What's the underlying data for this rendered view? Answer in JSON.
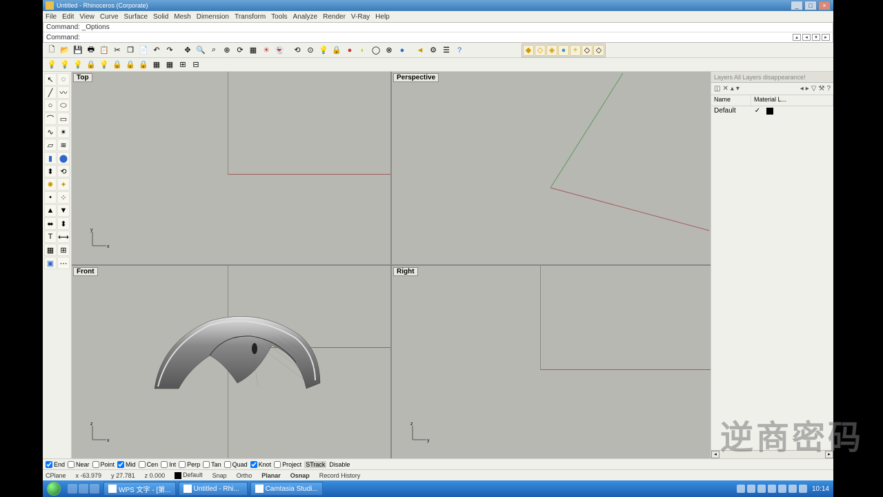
{
  "title": "Untitled - Rhinoceros (Corporate)",
  "menus": [
    "File",
    "Edit",
    "View",
    "Curve",
    "Surface",
    "Solid",
    "Mesh",
    "Dimension",
    "Transform",
    "Tools",
    "Analyze",
    "Render",
    "V-Ray",
    "Help"
  ],
  "cmd_prev": "Command: _Options",
  "cmd_prompt": "Command:",
  "viewports": {
    "top": "Top",
    "persp": "Perspective",
    "front": "Front",
    "right": "Right"
  },
  "layers_panel": {
    "tab": "Layers    All Layers disappearance!",
    "cols": {
      "name": "Name",
      "material": "Material  L..."
    },
    "row": {
      "name": "Default",
      "on": "✓"
    }
  },
  "osnap": {
    "end": "End",
    "near": "Near",
    "point": "Point",
    "mid": "Mid",
    "cen": "Cen",
    "int": "Int",
    "perp": "Perp",
    "tan": "Tan",
    "quad": "Quad",
    "knot": "Knot",
    "project": "Project",
    "strack": "STrack",
    "disable": "Disable"
  },
  "status": {
    "cplane": "CPlane",
    "x": "x -63.979",
    "y": "y 27.781",
    "z": "z 0.000",
    "layer": "Default",
    "snap": "Snap",
    "ortho": "Ortho",
    "planar": "Planar",
    "osnap": "Osnap",
    "record": "Record History"
  },
  "taskbar": {
    "tasks": [
      "WPS 文字 - [第...",
      "Untitled - Rhi...",
      "Camtasia Studi..."
    ],
    "clock": "10:14"
  },
  "watermark": "逆商密码"
}
